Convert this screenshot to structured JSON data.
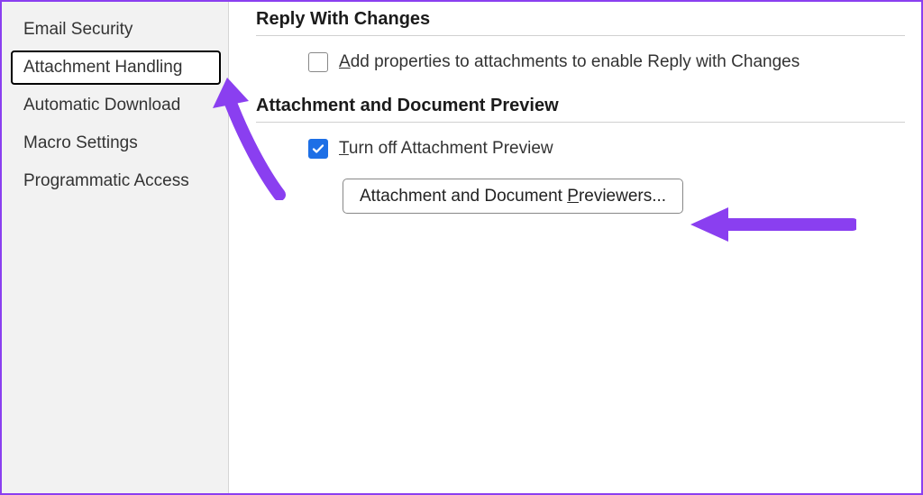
{
  "sidebar": {
    "items": [
      {
        "label": "Email Security"
      },
      {
        "label": "Attachment Handling"
      },
      {
        "label": "Automatic Download"
      },
      {
        "label": "Macro Settings"
      },
      {
        "label": "Programmatic Access"
      }
    ]
  },
  "content": {
    "section1_heading": "Reply With Changes",
    "reply_label_pre": "A",
    "reply_label_post": "dd properties to attachments to enable Reply with Changes",
    "section2_heading": "Attachment and Document Preview",
    "turnoff_label_pre": "T",
    "turnoff_label_post": "urn off Attachment Preview",
    "previewers_btn_pre": "Attachment and Document ",
    "previewers_btn_mid": "P",
    "previewers_btn_post": "reviewers..."
  },
  "colors": {
    "accent": "#8a3ff0",
    "checkbox_checked": "#1d6fe6"
  }
}
